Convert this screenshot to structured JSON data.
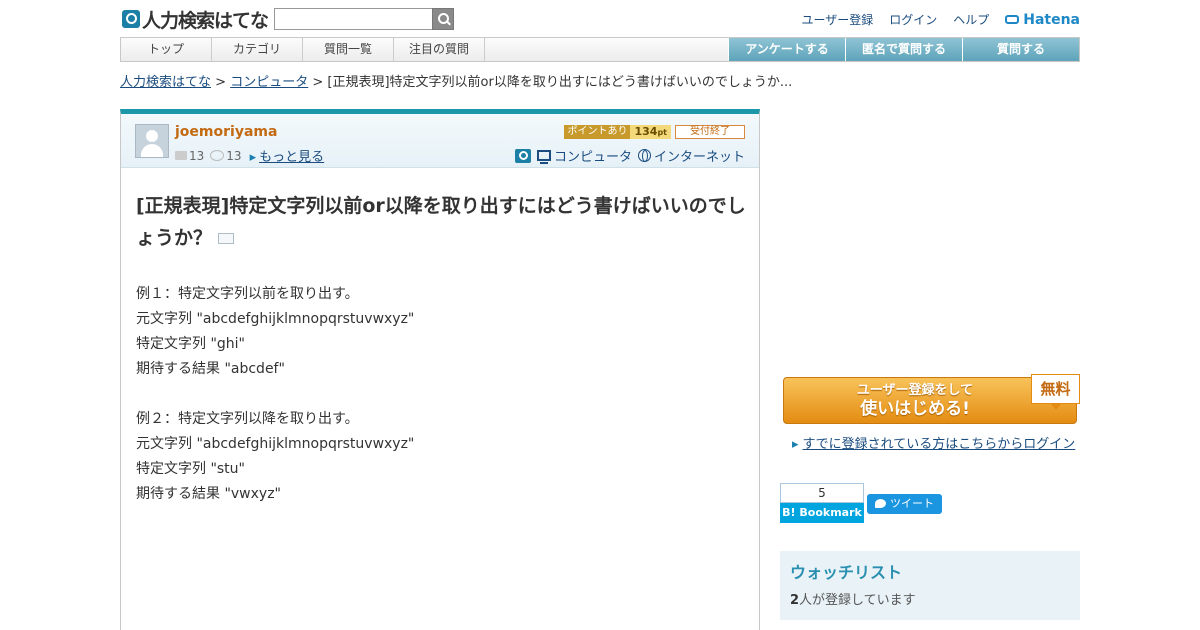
{
  "header": {
    "logo_text": "人力検索はてな",
    "search_placeholder": "",
    "links": [
      "ユーザー登録",
      "ログイン",
      "ヘルプ"
    ],
    "hatena_logo": "Hatena"
  },
  "nav": {
    "items": [
      "トップ",
      "カテゴリ",
      "質問一覧",
      "注目の質問"
    ],
    "actions": [
      "アンケートする",
      "匿名で質問する",
      "質問する"
    ]
  },
  "breadcrumb": {
    "home": "人力検索はてな",
    "sep1": " > ",
    "category": "コンピュータ",
    "sep2": " > ",
    "current": "[正規表現]特定文字列以前or以降を取り出すにはどう書けばいいのでしょうか..."
  },
  "question": {
    "username": "joemoriyama",
    "stat_questions": "13",
    "stat_answers": "13",
    "more_label": "もっと見る",
    "point_label": "ポイントあり",
    "points": "134",
    "points_unit": "pt",
    "status": "受付終了",
    "categories": [
      "コンピュータ",
      "インターネット"
    ],
    "title": "[正規表現]特定文字列以前or以降を取り出すにはどう書けばいいのでしょうか？",
    "body": [
      "例１：特定文字列以前を取り出す。",
      "元文字列 \"abcdefghijklmnopqrstuvwxyz\"",
      "特定文字列 \"ghi\"",
      "期待する結果 \"abcdef\"",
      "",
      "例２：特定文字列以降を取り出す。",
      "元文字列 \"abcdefghijklmnopqrstuvwxyz\"",
      "特定文字列 \"stu\"",
      "期待する結果 \"vwxyz\""
    ]
  },
  "sidebar": {
    "register_line1": "ユーザー登録をして",
    "register_line2": "使いはじめる!",
    "free_label": "無料",
    "login_link": "すでに登録されている方はこちらからログイン",
    "bookmark_count": "5",
    "bookmark_label": "B! Bookmark",
    "tweet_label": "ツイート",
    "watchlist_title": "ウォッチリスト",
    "watchlist_count": "2",
    "watchlist_suffix": "人が登録しています"
  },
  "colors": {
    "accent_teal": "#1d98a9",
    "link_blue": "#1a4c7f",
    "username_orange": "#c36a12",
    "register_orange": "#e48c12"
  }
}
